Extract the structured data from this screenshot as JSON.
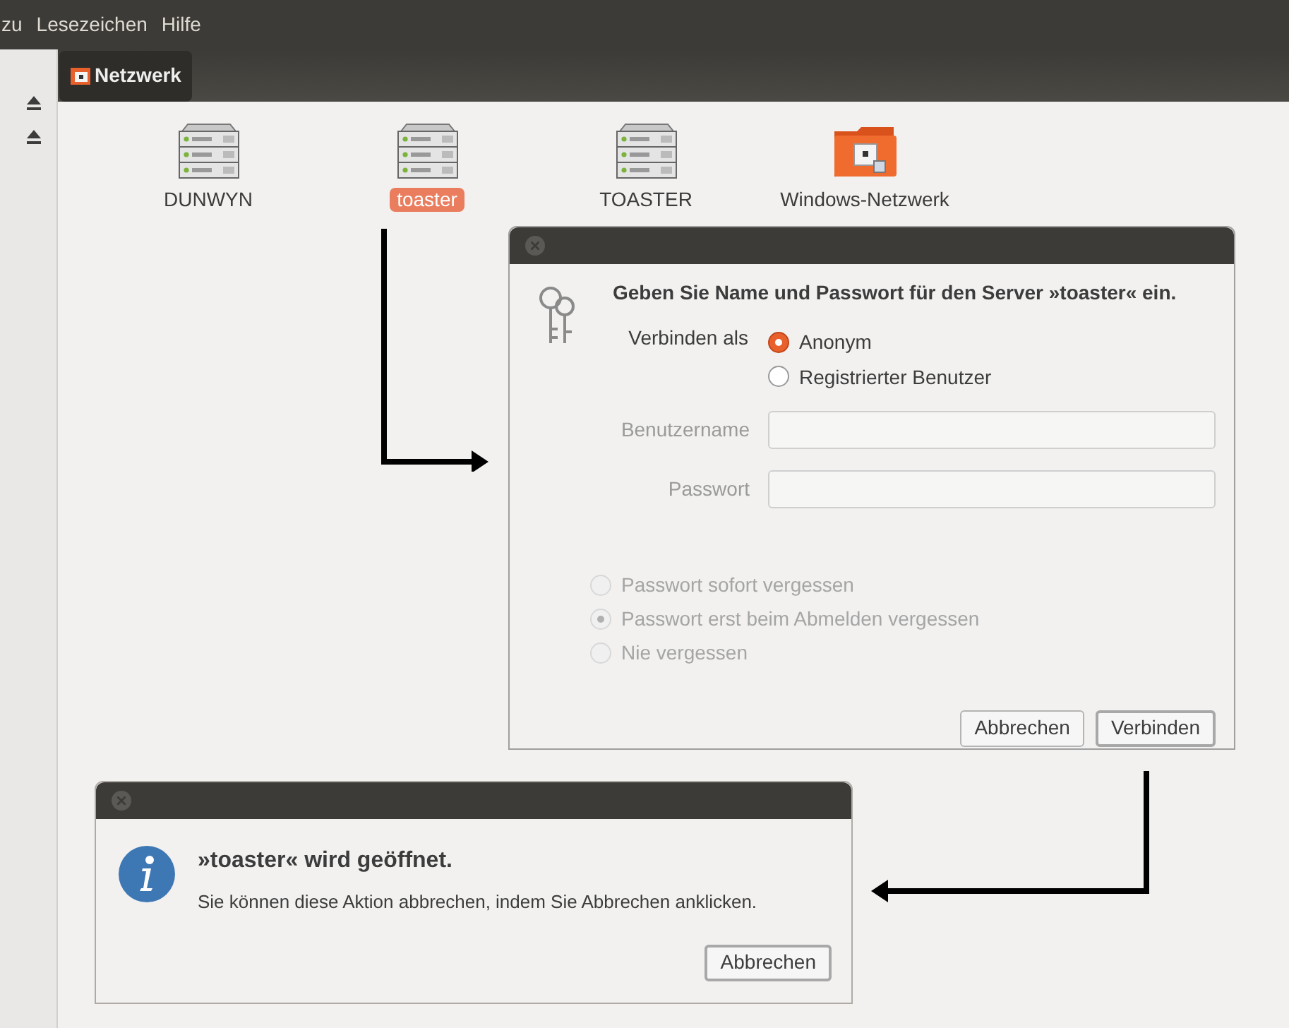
{
  "menubar": {
    "items": [
      "zu",
      "Lesezeichen",
      "Hilfe"
    ]
  },
  "location": {
    "label": "Netzwerk"
  },
  "items": [
    {
      "label": "DUNWYN",
      "kind": "server",
      "selected": false
    },
    {
      "label": "toaster",
      "kind": "server",
      "selected": true
    },
    {
      "label": "TOASTER",
      "kind": "server",
      "selected": false
    },
    {
      "label": "Windows-Netzwerk",
      "kind": "folder",
      "selected": false
    }
  ],
  "auth_dialog": {
    "heading": "Geben Sie Name und Passwort für den Server »toaster« ein.",
    "connect_as_label": "Verbinden als",
    "connect_as_options": [
      {
        "label": "Anonym",
        "selected": true
      },
      {
        "label": "Registrierter Benutzer",
        "selected": false
      }
    ],
    "fields": [
      {
        "label": "Benutzername",
        "disabled": true
      },
      {
        "label": "Passwort",
        "disabled": true
      }
    ],
    "remember_options": [
      {
        "label": "Passwort sofort vergessen",
        "selected": false,
        "disabled": true
      },
      {
        "label": "Passwort erst beim Abmelden vergessen",
        "selected": true,
        "disabled": true
      },
      {
        "label": "Nie vergessen",
        "selected": false,
        "disabled": true
      }
    ],
    "buttons": [
      "Abbrechen",
      "Verbinden"
    ]
  },
  "progress_dialog": {
    "title": "»toaster« wird geöffnet.",
    "message": "Sie können diese Aktion abbrechen, indem Sie Abbrechen anklicken.",
    "buttons": [
      "Abbrechen"
    ]
  }
}
